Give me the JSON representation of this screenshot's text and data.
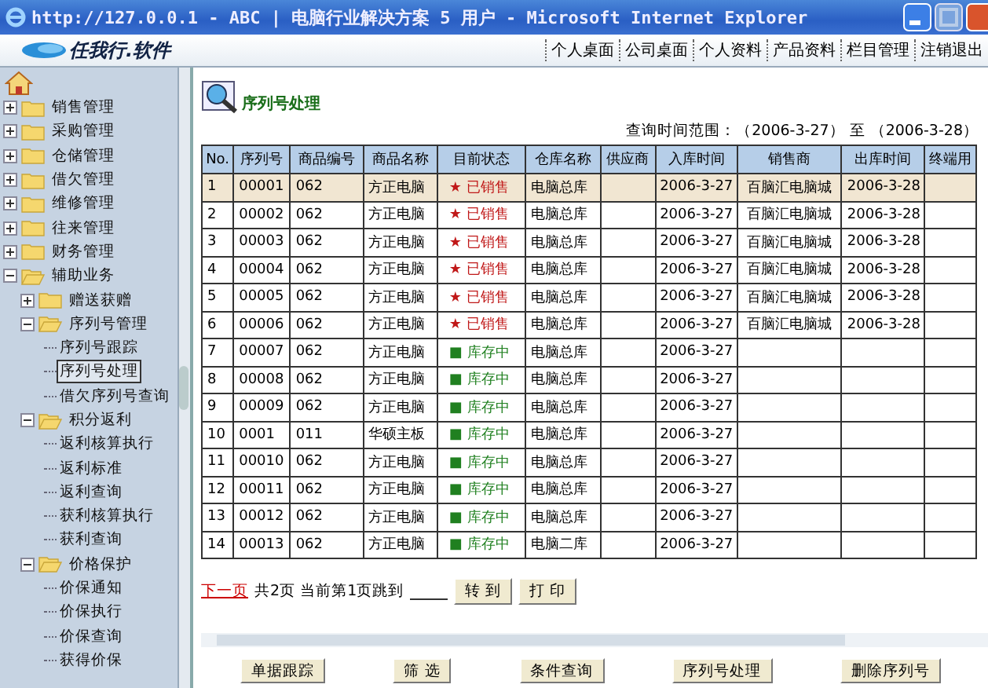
{
  "window": {
    "title": "http://127.0.0.1 - ABC  | 电脑行业解决方案 5 用户 - Microsoft Internet Explorer"
  },
  "header": {
    "logo": "任我行.软件",
    "nav": [
      "个人桌面",
      "公司桌面",
      "个人资料",
      "产品资料",
      "栏目管理",
      "注销退出"
    ]
  },
  "sidebar": {
    "items": [
      {
        "label": "销售管理",
        "kind": "folder",
        "expanded": false,
        "selected": false
      },
      {
        "label": "采购管理",
        "kind": "folder",
        "expanded": false,
        "selected": false
      },
      {
        "label": "仓储管理",
        "kind": "folder",
        "expanded": false,
        "selected": false
      },
      {
        "label": "借欠管理",
        "kind": "folder",
        "expanded": false,
        "selected": false
      },
      {
        "label": "维修管理",
        "kind": "folder",
        "expanded": false,
        "selected": false
      },
      {
        "label": "往来管理",
        "kind": "folder",
        "expanded": false,
        "selected": false
      },
      {
        "label": "财务管理",
        "kind": "folder",
        "expanded": false,
        "selected": false
      },
      {
        "label": "辅助业务",
        "kind": "folder",
        "expanded": true,
        "selected": false,
        "children": [
          {
            "label": "赠送获赠",
            "kind": "folder",
            "expanded": false,
            "selected": false
          },
          {
            "label": "序列号管理",
            "kind": "folder",
            "expanded": true,
            "selected": false,
            "children": [
              {
                "label": "序列号跟踪",
                "kind": "leaf",
                "selected": false
              },
              {
                "label": "序列号处理",
                "kind": "leaf",
                "selected": true
              },
              {
                "label": "借欠序列号查询",
                "kind": "leaf",
                "selected": false
              }
            ]
          },
          {
            "label": "积分返利",
            "kind": "folder",
            "expanded": true,
            "selected": false,
            "children": [
              {
                "label": "返利核算执行",
                "kind": "leaf",
                "selected": false
              },
              {
                "label": "返利标准",
                "kind": "leaf",
                "selected": false
              },
              {
                "label": "返利查询",
                "kind": "leaf",
                "selected": false
              },
              {
                "label": "获利核算执行",
                "kind": "leaf",
                "selected": false
              },
              {
                "label": "获利查询",
                "kind": "leaf",
                "selected": false
              }
            ]
          },
          {
            "label": "价格保护",
            "kind": "folder",
            "expanded": true,
            "selected": false,
            "children": [
              {
                "label": "价保通知",
                "kind": "leaf",
                "selected": false
              },
              {
                "label": "价保执行",
                "kind": "leaf",
                "selected": false
              },
              {
                "label": "价保查询",
                "kind": "leaf",
                "selected": false
              },
              {
                "label": "获得价保",
                "kind": "leaf",
                "selected": false
              }
            ]
          }
        ]
      }
    ]
  },
  "page": {
    "title": "序列号处理",
    "query_range": "查询时间范围：（2006-3-27） 至 （2006-3-28）"
  },
  "table": {
    "columns": [
      "No.",
      "序列号",
      "商品编号",
      "商品名称",
      "目前状态",
      "仓库名称",
      "供应商",
      "入库时间",
      "销售商",
      "出库时间",
      "终端用"
    ],
    "rows": [
      {
        "selected": true,
        "color": "#c01818",
        "cells": [
          "1",
          "00001",
          "062",
          "方正电脑",
          "★ 已销售",
          "电脑总库",
          "",
          "2006-3-27",
          "百脑汇电脑城",
          "2006-3-28",
          ""
        ]
      },
      {
        "selected": false,
        "color": "#c01818",
        "cells": [
          "2",
          "00002",
          "062",
          "方正电脑",
          "★ 已销售",
          "电脑总库",
          "",
          "2006-3-27",
          "百脑汇电脑城",
          "2006-3-28",
          ""
        ]
      },
      {
        "selected": false,
        "color": "#c01818",
        "cells": [
          "3",
          "00003",
          "062",
          "方正电脑",
          "★ 已销售",
          "电脑总库",
          "",
          "2006-3-27",
          "百脑汇电脑城",
          "2006-3-28",
          ""
        ]
      },
      {
        "selected": false,
        "color": "#c01818",
        "cells": [
          "4",
          "00004",
          "062",
          "方正电脑",
          "★ 已销售",
          "电脑总库",
          "",
          "2006-3-27",
          "百脑汇电脑城",
          "2006-3-28",
          ""
        ]
      },
      {
        "selected": false,
        "color": "#c01818",
        "cells": [
          "5",
          "00005",
          "062",
          "方正电脑",
          "★ 已销售",
          "电脑总库",
          "",
          "2006-3-27",
          "百脑汇电脑城",
          "2006-3-28",
          ""
        ]
      },
      {
        "selected": false,
        "color": "#c01818",
        "cells": [
          "6",
          "00006",
          "062",
          "方正电脑",
          "★ 已销售",
          "电脑总库",
          "",
          "2006-3-27",
          "百脑汇电脑城",
          "2006-3-28",
          ""
        ]
      },
      {
        "selected": false,
        "color": "#208020",
        "cells": [
          "7",
          "00007",
          "062",
          "方正电脑",
          "■ 库存中",
          "电脑总库",
          "",
          "2006-3-27",
          "",
          "",
          ""
        ]
      },
      {
        "selected": false,
        "color": "#208020",
        "cells": [
          "8",
          "00008",
          "062",
          "方正电脑",
          "■ 库存中",
          "电脑总库",
          "",
          "2006-3-27",
          "",
          "",
          ""
        ]
      },
      {
        "selected": false,
        "color": "#208020",
        "cells": [
          "9",
          "00009",
          "062",
          "方正电脑",
          "■ 库存中",
          "电脑总库",
          "",
          "2006-3-27",
          "",
          "",
          ""
        ]
      },
      {
        "selected": false,
        "color": "#208020",
        "cells": [
          "10",
          "0001",
          "011",
          "华硕主板",
          "■ 库存中",
          "电脑总库",
          "",
          "2006-3-27",
          "",
          "",
          ""
        ]
      },
      {
        "selected": false,
        "color": "#208020",
        "cells": [
          "11",
          "00010",
          "062",
          "方正电脑",
          "■ 库存中",
          "电脑总库",
          "",
          "2006-3-27",
          "",
          "",
          ""
        ]
      },
      {
        "selected": false,
        "color": "#208020",
        "cells": [
          "12",
          "00011",
          "062",
          "方正电脑",
          "■ 库存中",
          "电脑总库",
          "",
          "2006-3-27",
          "",
          "",
          ""
        ]
      },
      {
        "selected": false,
        "color": "#208020",
        "cells": [
          "13",
          "00012",
          "062",
          "方正电脑",
          "■ 库存中",
          "电脑总库",
          "",
          "2006-3-27",
          "",
          "",
          ""
        ]
      },
      {
        "selected": false,
        "color": "#208020",
        "cells": [
          "14",
          "00013",
          "062",
          "方正电脑",
          "■ 库存中",
          "电脑二库",
          "",
          "2006-3-27",
          "",
          "",
          ""
        ]
      }
    ]
  },
  "pager": {
    "next": "下一页",
    "info": "共2页 当前第1页跳到",
    "go": "转 到",
    "print": "打 印"
  },
  "buttons": [
    "单据跟踪",
    "筛 选",
    "条件查询",
    "序列号处理",
    "删除序列号"
  ]
}
